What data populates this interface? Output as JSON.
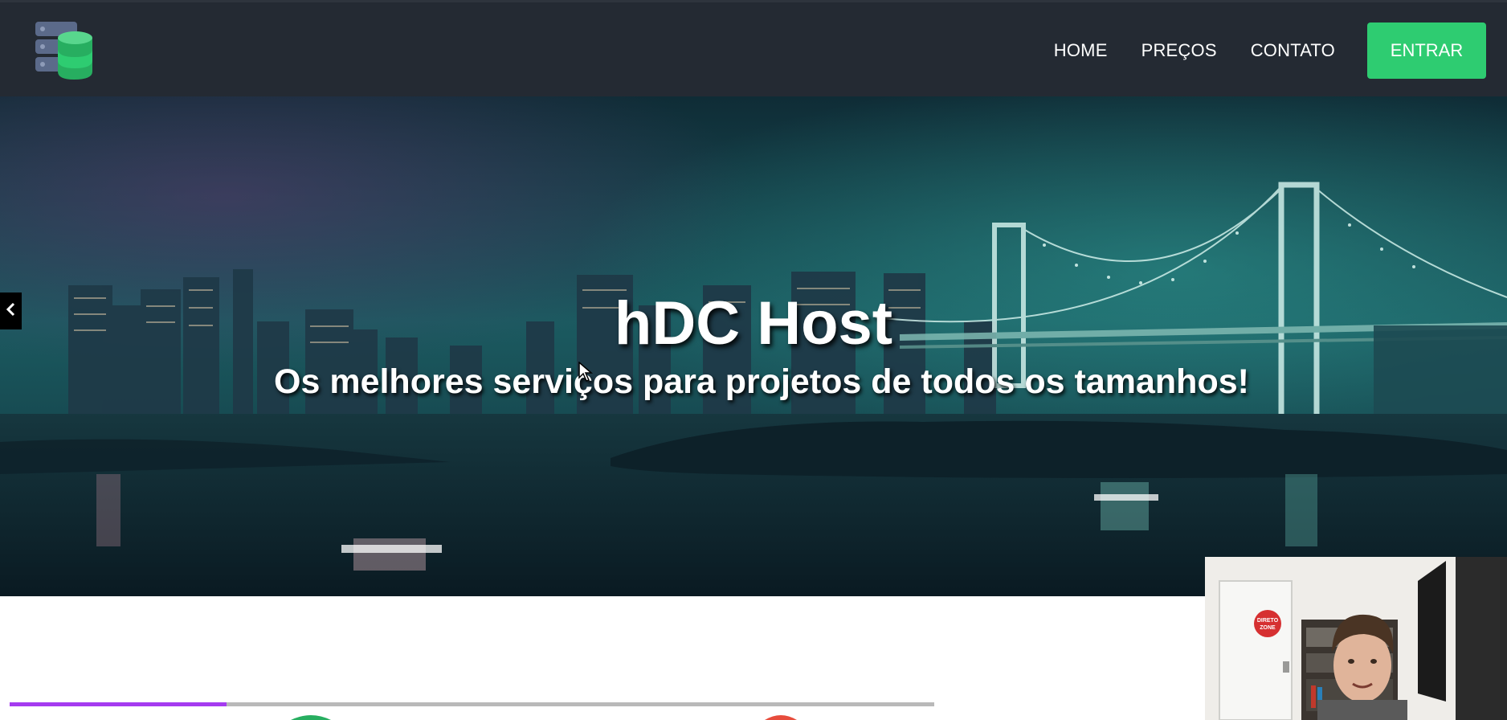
{
  "navbar": {
    "logo_icon": "database-server-icon",
    "links": [
      {
        "label": "HOME"
      },
      {
        "label": "PREÇOS"
      },
      {
        "label": "CONTATO"
      }
    ],
    "login_label": "ENTRAR",
    "colors": {
      "background": "#242a33",
      "login_button": "#2ecc71"
    }
  },
  "hero": {
    "title": "hDC Host",
    "subtitle": "Os melhores serviços para projetos de todos os tamanhos!",
    "prev_icon": "chevron-left-icon",
    "background": "night city skyline with illuminated suspension bridge over water"
  },
  "player": {
    "progress": 0.235,
    "progress_color": "#a53bf0",
    "webcam_sign_text": [
      "DIRETO",
      "ZONE"
    ]
  }
}
